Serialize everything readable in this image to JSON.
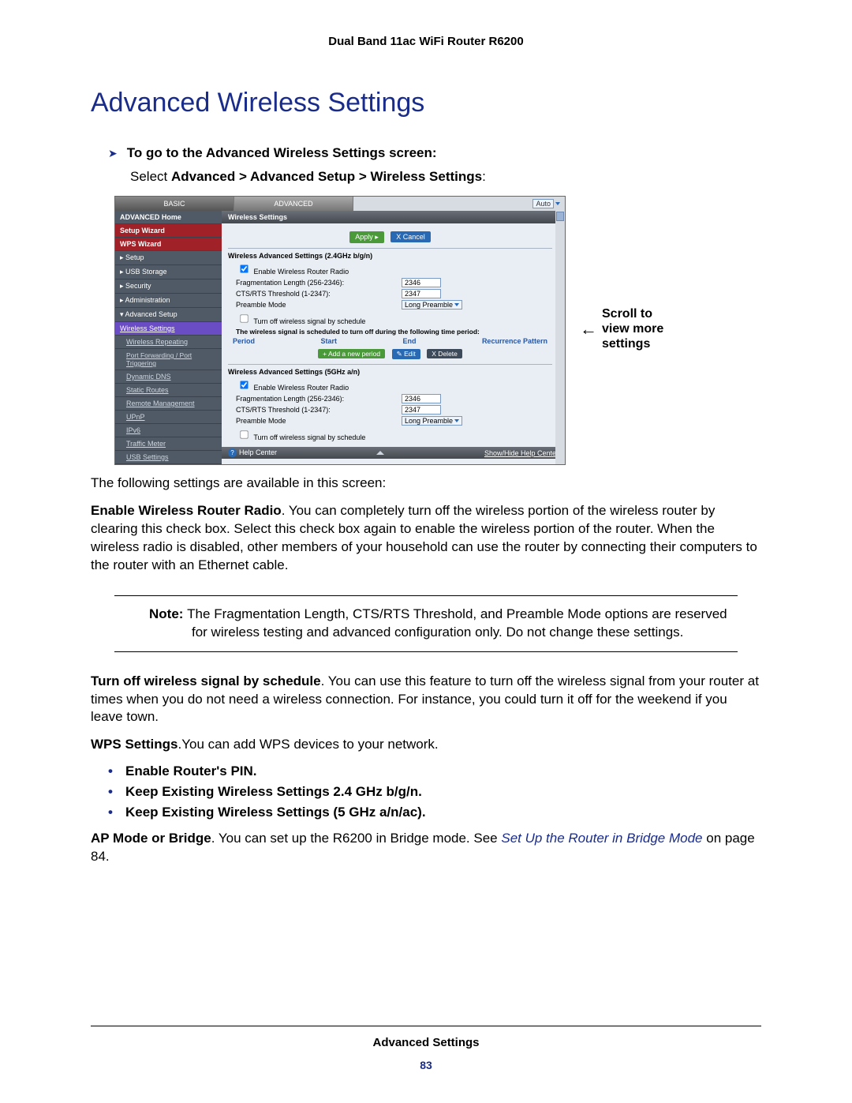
{
  "header": "Dual Band 11ac WiFi Router R6200",
  "title": "Advanced Wireless Settings",
  "step": "To go to the Advanced Wireless Settings screen:",
  "select_prefix": "Select ",
  "select_path": "Advanced > Advanced Setup > Wireless Settings",
  "select_suffix": ":",
  "annotation": "Scroll to view more settings",
  "p1": "The following settings are available in this screen:",
  "p2a": "Enable Wireless Router Radio",
  "p2b": ". You can completely turn off the wireless portion of the wireless router by clearing this check box. Select this check box again to enable the wireless portion of the router. When the wireless radio is disabled, other members of your household can use the router by connecting their computers to the router with an Ethernet cable.",
  "note_label": "Note:  ",
  "note_body": "The Fragmentation Length, CTS/RTS Threshold, and Preamble Mode options are reserved for wireless testing and advanced configuration only. Do not change these settings.",
  "p3a": "Turn off wireless signal by schedule",
  "p3b": ". You can use this feature to turn off the wireless signal from your router at times when you do not need a wireless connection. For instance, you could turn it off for the weekend if you leave town.",
  "p4a": "WPS Settings",
  "p4b": ".You can add WPS devices to your network.",
  "bullets": [
    "Enable Router's PIN.",
    "Keep Existing Wireless Settings 2.4 GHz b/g/n.",
    "Keep Existing Wireless Settings (5 GHz a/n/ac)."
  ],
  "p5a": "AP Mode or Bridge",
  "p5b": ". You can set up the R6200 in Bridge mode. See ",
  "p5link": "Set Up the Router in Bridge Mode",
  "p5c": " on page 84.",
  "footer_title": "Advanced Settings",
  "footer_page": "83",
  "shot": {
    "tab_basic": "BASIC",
    "tab_advanced": "ADVANCED",
    "auto": "Auto",
    "sidebar": {
      "home": "ADVANCED Home",
      "setup_wizard": "Setup Wizard",
      "wps_wizard": "WPS Wizard",
      "setup": "▸ Setup",
      "usb": "▸ USB Storage",
      "security": "▸ Security",
      "admin": "▸ Administration",
      "adv_setup": "▾ Advanced Setup",
      "wireless_settings": "Wireless Settings",
      "wireless_repeating": "Wireless Repeating",
      "port_fwd": "Port Forwarding / Port Triggering",
      "ddns": "Dynamic DNS",
      "static_routes": "Static Routes",
      "remote_mgmt": "Remote Management",
      "upnp": "UPnP",
      "ipv6": "IPv6",
      "traffic": "Traffic Meter",
      "usb_settings": "USB Settings"
    },
    "content": {
      "title": "Wireless Settings",
      "apply": "Apply ▸",
      "cancel": "X Cancel",
      "sec1": "Wireless Advanced Settings (2.4GHz b/g/n)",
      "enable_radio": "Enable Wireless Router Radio",
      "frag": "Fragmentation Length (256-2346):",
      "frag_val": "2346",
      "cts": "CTS/RTS Threshold (1-2347):",
      "cts_val": "2347",
      "preamble": "Preamble Mode",
      "preamble_val": "Long Preamble",
      "turnoff": "Turn off wireless signal by schedule",
      "sched_note": "The wireless signal is scheduled to turn off during the following time period:",
      "h_period": "Period",
      "h_start": "Start",
      "h_end": "End",
      "h_recur": "Recurrence Pattern",
      "add": "+ Add a new period",
      "edit": "✎ Edit",
      "delete": "X Delete",
      "sec2": "Wireless Advanced Settings (5GHz a/n)",
      "help_center": "Help Center",
      "show_hide": "Show/Hide Help Center"
    }
  }
}
